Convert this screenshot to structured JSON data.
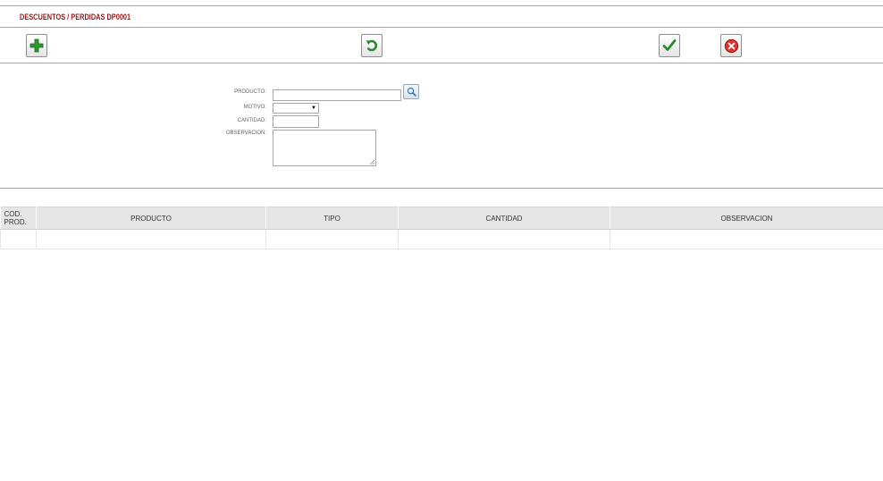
{
  "header": {
    "title": "DESCUENTOS / PERDIDAS DP0001"
  },
  "toolbar": {
    "new_icon": "plus-icon",
    "refresh_icon": "undo-icon",
    "accept_icon": "checkmark-icon",
    "cancel_icon": "cancel-circle-icon"
  },
  "form": {
    "producto_label": "PRODUCTO:",
    "producto_value": "",
    "motivo_label": "MOTIVO:",
    "motivo_value": "",
    "cantidad_label": "CANTIDAD:",
    "cantidad_value": "",
    "observacion_label": "OBSERVACION:",
    "observacion_value": "",
    "search_icon": "magnifier-icon"
  },
  "table": {
    "columns": [
      "COD. PROD.",
      "PRODUCTO",
      "TIPO",
      "CANTIDAD",
      "OBSERVACION"
    ],
    "rows": [
      [
        "",
        "",
        "",
        "",
        ""
      ]
    ]
  },
  "colors": {
    "title": "#8b1a1a",
    "icon_green": "#2e8b2e",
    "icon_red": "#d42020",
    "header_bg": "#e5e5e5"
  }
}
